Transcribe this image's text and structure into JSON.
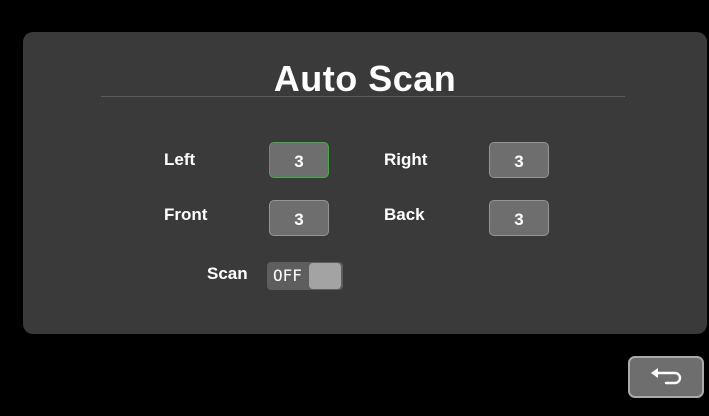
{
  "title": "Auto Scan",
  "fields": {
    "left": {
      "label": "Left",
      "value": "3",
      "selected": true
    },
    "right": {
      "label": "Right",
      "value": "3",
      "selected": false
    },
    "front": {
      "label": "Front",
      "value": "3",
      "selected": false
    },
    "back": {
      "label": "Back",
      "value": "3",
      "selected": false
    }
  },
  "scan": {
    "label": "Scan",
    "state": "OFF"
  },
  "nav": {
    "back_icon": "return-arrow-icon"
  },
  "colors": {
    "background": "#000000",
    "panel": "#3a3a3a",
    "button": "#6e6e6e",
    "selected_border": "#3fae3f",
    "toggle_knob": "#a3a3a3"
  }
}
